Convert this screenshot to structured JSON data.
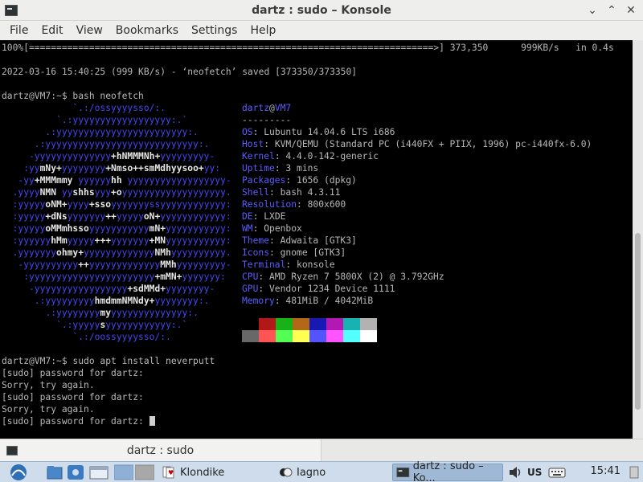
{
  "window": {
    "title": "dartz : sudo – Konsole",
    "controls": [
      "⌄",
      "⌃",
      "✕"
    ]
  },
  "menu": [
    "File",
    "Edit",
    "View",
    "Bookmarks",
    "Settings",
    "Help"
  ],
  "terminal": {
    "top_lines": [
      "100%[==========================================================================>] 373,350      999KB/s   in 0.4s",
      "",
      "2022-03-16 15:40:25 (999 KB/s) - ‘neofetch’ saved [373350/373350]",
      "",
      "dartz@VM7:~$ bash neofetch"
    ],
    "logo": [
      "             `.:/ossyyyysso/:.",
      "          `.:yyyyyyyyyyyyyyyyyy:.`",
      "        .:yyyyyyyyyyyyyyyyyyyyyyyy:.",
      "      .:yyyyyyyyyyyyyyyyyyyyyyyyyyyy:.",
      "     -yyyyyyyyyyyyyy+hNMMMNh+yyyyyyyyy-",
      "    :yymNy+yyyyyyyy+Nmso++smMdhyysoo+yy:",
      "   -yy+MMMmmy yyyyyyhh yyyyyyyyyyyyyyyyyy-",
      "  .yyyyNMN yyshhsyyy+oyyyyyyyyyyyyyyyyyyy.",
      "  :yyyyyoNM+yyyy+ssoyyyyyyyssyyyyyyyyyyyy:",
      "  :yyyyy+dNsyyyyyyy++yyyyyoN+yyyyyyyyyyyy:",
      "  :yyyyyoMMmhssoyyyyyyyyyyymN+yyyyyyyyyyy:",
      "  :yyyyyyhMmyyyyy+++yyyyyyy+MNyyyyyyyyyyy:",
      "  .yyyyyyyohmy+yyyyyyyyyyyyyNMhyyyyyyyyyy.",
      "   -yyyyyyyyyy++yyyyyyyyyyyyyMMhyyyyyyyyy-",
      "    :yyyyyyyyyyyyyyyyyyyyyyy+mMN+yyyyyyy:",
      "     -yyyyyyyyyyyyyyyyy+sdMMd+yyyyyyyy-",
      "      .:yyyyyyyyyhmdmmNMNdy+yyyyyyyy:.",
      "        .:yyyyyyyymyyyyyyyyyyyyyyy:.",
      "          `.:yyyyysyyyyyyyyyyyy:.`",
      "             `.:/oossyyyysso/:."
    ],
    "bold_parts": [
      [],
      [],
      [],
      [],
      [
        "+hNMMMNh+"
      ],
      [
        "mNy+",
        "+Nmso++smMdhyysoo+"
      ],
      [
        "+MMMmmy",
        "hh"
      ],
      [
        "NMN",
        "shhs",
        "+o"
      ],
      [
        "oNM+",
        "+sso",
        "ss"
      ],
      [
        "+dNs",
        "++",
        "oN+"
      ],
      [
        "oMMmhsso",
        "mN+"
      ],
      [
        "hMm",
        "+++",
        "+MN"
      ],
      [
        "ohmy+",
        "NMh"
      ],
      [
        "++",
        "MMh"
      ],
      [
        "+mMN+"
      ],
      [
        "+sdMMd+"
      ],
      [
        "hmdmmNMNdy+"
      ],
      [
        "my"
      ],
      [
        "s"
      ],
      []
    ],
    "info_user": "dartz",
    "info_at": "@",
    "info_host": "VM7",
    "info_sep": "---------",
    "info": [
      {
        "label": "OS",
        "value": "Lubuntu 14.04.6 LTS i686"
      },
      {
        "label": "Host",
        "value": "KVM/QEMU (Standard PC (i440FX + PIIX, 1996) pc-i440fx-6.0)"
      },
      {
        "label": "Kernel",
        "value": "4.4.0-142-generic"
      },
      {
        "label": "Uptime",
        "value": "3 mins"
      },
      {
        "label": "Packages",
        "value": "1656 (dpkg)"
      },
      {
        "label": "Shell",
        "value": "bash 4.3.11"
      },
      {
        "label": "Resolution",
        "value": "800x600"
      },
      {
        "label": "DE",
        "value": "LXDE"
      },
      {
        "label": "WM",
        "value": "Openbox"
      },
      {
        "label": "Theme",
        "value": "Adwaita [GTK3]"
      },
      {
        "label": "Icons",
        "value": "gnome [GTK3]"
      },
      {
        "label": "Terminal",
        "value": "konsole"
      },
      {
        "label": "CPU",
        "value": "AMD Ryzen 7 5800X (2) @ 3.792GHz"
      },
      {
        "label": "GPU",
        "value": "Vendor 1234 Device 1111"
      },
      {
        "label": "Memory",
        "value": "481MiB / 4042MiB"
      }
    ],
    "colors_top": [
      "#000000",
      "#b21818",
      "#18b218",
      "#b26818",
      "#1818b2",
      "#b218b2",
      "#18b2b2",
      "#b2b2b2"
    ],
    "colors_bottom": [
      "#686868",
      "#ff5454",
      "#54ff54",
      "#ffff54",
      "#5454ff",
      "#ff54ff",
      "#54ffff",
      "#ffffff"
    ],
    "bottom_lines": [
      "dartz@VM7:~$ sudo apt install neverputt",
      "[sudo] password for dartz:",
      "Sorry, try again.",
      "[sudo] password for dartz:",
      "Sorry, try again.",
      "[sudo] password for dartz: "
    ]
  },
  "tab": {
    "label": "dartz : sudo"
  },
  "panel": {
    "tasks": [
      {
        "label": "Klondike"
      },
      {
        "label": "Iagno"
      },
      {
        "label": "dartz : sudo – Ko..."
      }
    ],
    "keyboard_layout": "US",
    "clock": "15:41"
  }
}
